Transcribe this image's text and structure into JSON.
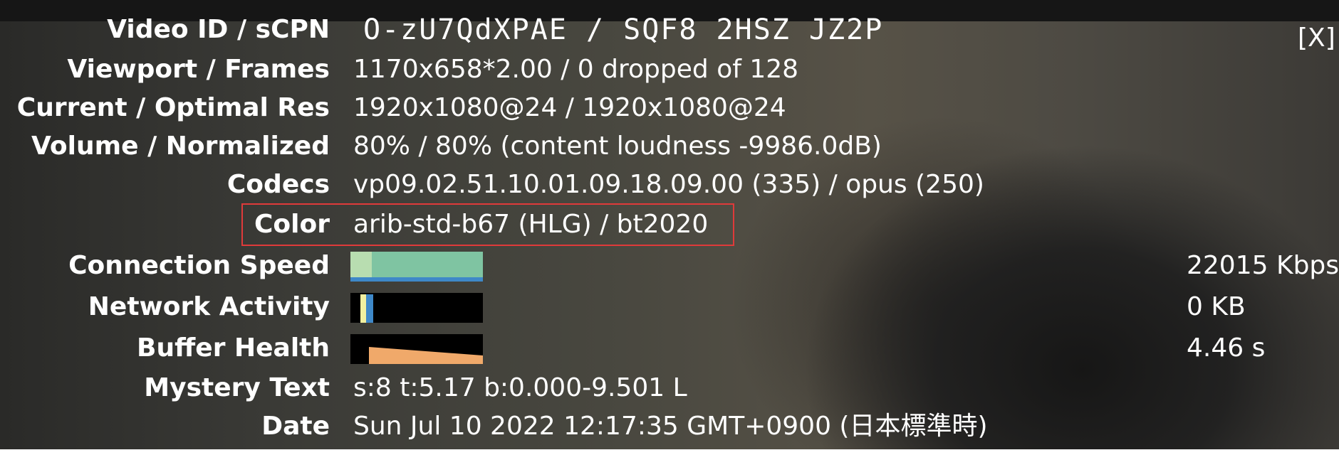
{
  "stats": {
    "video_id": {
      "label": "Video ID / sCPN",
      "value": "O-zU7QdXPAE  /  SQF8  2HSZ  JZ2P"
    },
    "viewport": {
      "label": "Viewport / Frames",
      "value": "1170x658*2.00 / 0 dropped of 128"
    },
    "resolution": {
      "label": "Current / Optimal Res",
      "value": "1920x1080@24 / 1920x1080@24"
    },
    "volume": {
      "label": "Volume / Normalized",
      "value": "80% / 80% (content loudness -9986.0dB)"
    },
    "codecs": {
      "label": "Codecs",
      "value": "vp09.02.51.10.01.09.18.09.00 (335) / opus (250)"
    },
    "color": {
      "label": "Color",
      "value": "arib-std-b67 (HLG) / bt2020"
    },
    "connection_speed": {
      "label": "Connection Speed",
      "value": "22015 Kbps"
    },
    "network_activity": {
      "label": "Network Activity",
      "value": "0 KB"
    },
    "buffer_health": {
      "label": "Buffer Health",
      "value": "4.46 s"
    },
    "mystery_text": {
      "label": "Mystery Text",
      "value": "s:8 t:5.17 b:0.000-9.501 L"
    },
    "date": {
      "label": "Date",
      "value": "Sun Jul 10 2022 12:17:35 GMT+0900 (日本標準時)"
    }
  },
  "close_button": "[X]",
  "colors": {
    "highlight_border": "#e03a3a",
    "connection_graph": "#7fc4a2",
    "connection_graph_light": "#b8ddb0",
    "network_graph_blue": "#3e88c8",
    "network_graph_yellow": "#f1f0a0",
    "buffer_graph": "#f0a96a"
  }
}
